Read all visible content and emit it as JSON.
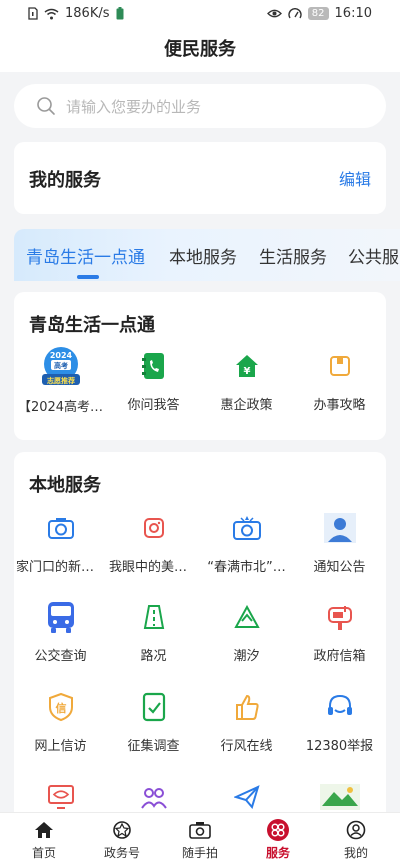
{
  "statusbar": {
    "speed": "186K/s",
    "battery": "82",
    "time": "16:10"
  },
  "header": {
    "title": "便民服务"
  },
  "search": {
    "placeholder": "请输入您要办的业务"
  },
  "my_service": {
    "title": "我的服务",
    "edit": "编辑"
  },
  "tabs": [
    {
      "label": "青岛生活一点通"
    },
    {
      "label": "本地服务"
    },
    {
      "label": "生活服务"
    },
    {
      "label": "公共服"
    }
  ],
  "qingdao": {
    "title": "青岛生活一点通",
    "badge_year": "2024",
    "badge_top": "高考",
    "badge_bottom": "志愿推荐",
    "items": [
      {
        "label": "【2024高考…",
        "icon": "gaokao-badge-icon"
      },
      {
        "label": "你问我答",
        "icon": "phone-book-icon"
      },
      {
        "label": "惠企政策",
        "icon": "house-yen-icon"
      },
      {
        "label": "办事攻略",
        "icon": "folder-icon"
      }
    ]
  },
  "local": {
    "title": "本地服务",
    "items": [
      {
        "label": "家门口的新变…",
        "icon": "camera-icon"
      },
      {
        "label": "我眼中的美丽…",
        "icon": "photo-camera-icon"
      },
      {
        "label": "“春满市北”…",
        "icon": "flash-camera-icon"
      },
      {
        "label": "通知公告",
        "icon": "person-announcement-icon"
      },
      {
        "label": "公交查询",
        "icon": "bus-icon"
      },
      {
        "label": "路况",
        "icon": "road-icon"
      },
      {
        "label": "潮汐",
        "icon": "triangle-icon"
      },
      {
        "label": "政府信箱",
        "icon": "mailbox-icon"
      },
      {
        "label": "网上信访",
        "icon": "letter-shield-icon"
      },
      {
        "label": "征集调查",
        "icon": "survey-check-icon"
      },
      {
        "label": "行风在线",
        "icon": "thumbs-up-icon"
      },
      {
        "label": "12380举报",
        "icon": "headset-icon"
      }
    ]
  },
  "bottom_nav": [
    {
      "label": "首页",
      "icon": "home-icon"
    },
    {
      "label": "政务号",
      "icon": "badge-icon"
    },
    {
      "label": "随手拍",
      "icon": "camera-icon"
    },
    {
      "label": "服务",
      "icon": "services-icon"
    },
    {
      "label": "我的",
      "icon": "user-icon"
    }
  ],
  "colors": {
    "accent": "#2a7be6",
    "active_nav": "#c8102e"
  }
}
